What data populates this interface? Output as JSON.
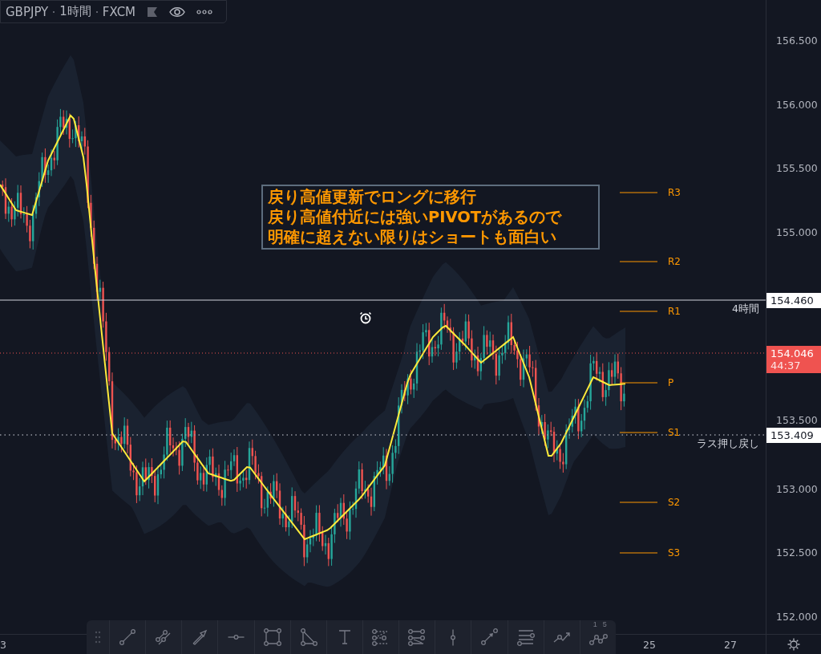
{
  "legend": {
    "symbol": "GBPJPY",
    "interval": "1時間",
    "source": "FXCM"
  },
  "annotation": {
    "lines": [
      "戻り高値更新でロングに移行",
      "戻り高値付近には強いPIVOTがあるので",
      "明確に超えない限りはショートも面白い"
    ]
  },
  "pivots": [
    "R3",
    "R2",
    "R1",
    "P",
    "S1",
    "S2",
    "S3"
  ],
  "levels": [
    {
      "kind": "alert_line",
      "price": "154.460",
      "label": "4時間"
    },
    {
      "kind": "last_price",
      "price": "154.046",
      "countdown": "44:37"
    },
    {
      "kind": "dotted",
      "price": "153.409",
      "label": "ラス押し戻し"
    }
  ],
  "price_axis": [
    "156.500",
    "156.000",
    "155.500",
    "155.000",
    "153.500",
    "153.000",
    "152.500",
    "152.000"
  ],
  "time_axis": [
    "3",
    "25",
    "27"
  ],
  "toolbar": {
    "path_tool_labels": [
      "1",
      "5"
    ]
  }
}
